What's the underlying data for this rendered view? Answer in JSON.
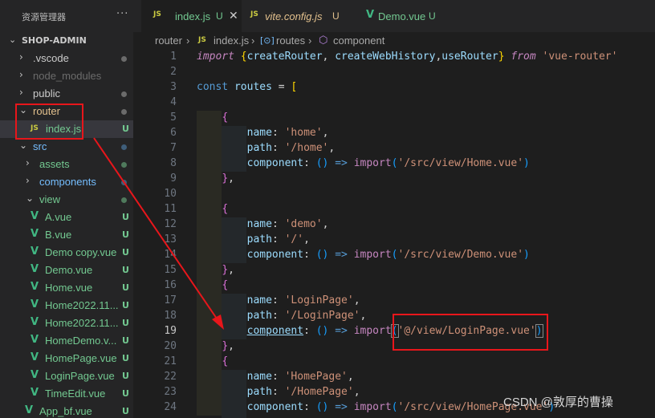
{
  "explorer": {
    "title": "资源管理器",
    "more": "···",
    "project": "SHOP-ADMIN",
    "items": [
      {
        "name": ".vscode",
        "kind": "folder",
        "chev": "›",
        "status": "dot",
        "tone": "plain"
      },
      {
        "name": "node_modules",
        "kind": "folder",
        "chev": "›",
        "status": "",
        "tone": "dim"
      },
      {
        "name": "public",
        "kind": "folder",
        "chev": "›",
        "status": "dot",
        "tone": "plain"
      },
      {
        "name": "router",
        "kind": "folder-open",
        "chev": "⌄",
        "status": "dot",
        "tone": "mod"
      },
      {
        "name": "index.js",
        "kind": "js",
        "icon": "JS",
        "status": "U",
        "tone": "new"
      },
      {
        "name": "src",
        "kind": "folder-open",
        "chev": "⌄",
        "status": "dot",
        "tone": "folder"
      },
      {
        "name": "assets",
        "kind": "folder",
        "chev": "›",
        "status": "dot",
        "tone": "new"
      },
      {
        "name": "components",
        "kind": "folder",
        "chev": "›",
        "status": "dot",
        "tone": "folder"
      },
      {
        "name": "view",
        "kind": "folder-open",
        "chev": "⌄",
        "status": "dot",
        "tone": "new"
      },
      {
        "name": "A.vue",
        "kind": "vue",
        "icon": "V",
        "status": "U",
        "tone": "new"
      },
      {
        "name": "B.vue",
        "kind": "vue",
        "icon": "V",
        "status": "U",
        "tone": "new"
      },
      {
        "name": "Demo copy.vue",
        "kind": "vue",
        "icon": "V",
        "status": "U",
        "tone": "new"
      },
      {
        "name": "Demo.vue",
        "kind": "vue",
        "icon": "V",
        "status": "U",
        "tone": "new"
      },
      {
        "name": "Home.vue",
        "kind": "vue",
        "icon": "V",
        "status": "U",
        "tone": "new"
      },
      {
        "name": "Home2022.11...",
        "kind": "vue",
        "icon": "V",
        "status": "U",
        "tone": "new"
      },
      {
        "name": "Home2022.11...",
        "kind": "vue",
        "icon": "V",
        "status": "U",
        "tone": "new"
      },
      {
        "name": "HomeDemo.v...",
        "kind": "vue",
        "icon": "V",
        "status": "U",
        "tone": "new"
      },
      {
        "name": "HomePage.vue",
        "kind": "vue",
        "icon": "V",
        "status": "U",
        "tone": "new"
      },
      {
        "name": "LoginPage.vue",
        "kind": "vue",
        "icon": "V",
        "status": "U",
        "tone": "new"
      },
      {
        "name": "TimeEdit.vue",
        "kind": "vue",
        "icon": "V",
        "status": "U",
        "tone": "new"
      },
      {
        "name": "App_bf.vue",
        "kind": "vue",
        "icon": "V",
        "status": "U",
        "tone": "new"
      }
    ]
  },
  "tabs": [
    {
      "icon": "JS",
      "label": "index.js",
      "status": "U",
      "close": "✕",
      "active": true
    },
    {
      "icon": "JS",
      "label": "vite.config.js",
      "status": "U",
      "active": false
    },
    {
      "icon": "V",
      "label": "Demo.vue",
      "status": "U",
      "active": false
    }
  ],
  "breadcrumb": {
    "seg1": "router",
    "sep": "›",
    "seg2_icon": "JS",
    "seg2": "index.js",
    "seg3_icon": "[⊙]",
    "seg3": "routes",
    "seg4_icon": "⬡",
    "seg4": "component"
  },
  "editor": {
    "current_line": 19,
    "line_numbers": [
      "1",
      "2",
      "3",
      "4",
      "5",
      "6",
      "7",
      "8",
      "9",
      "10",
      "11",
      "12",
      "13",
      "14",
      "15",
      "16",
      "17",
      "18",
      "19",
      "20",
      "21",
      "22",
      "23",
      "24"
    ]
  },
  "colors": {
    "accent": "#007acc",
    "annotation_red": "#e8161b",
    "untracked_green": "#73c991",
    "modified_yellow": "#e2c08d"
  },
  "watermark": "CSDN @敦厚的曹操"
}
